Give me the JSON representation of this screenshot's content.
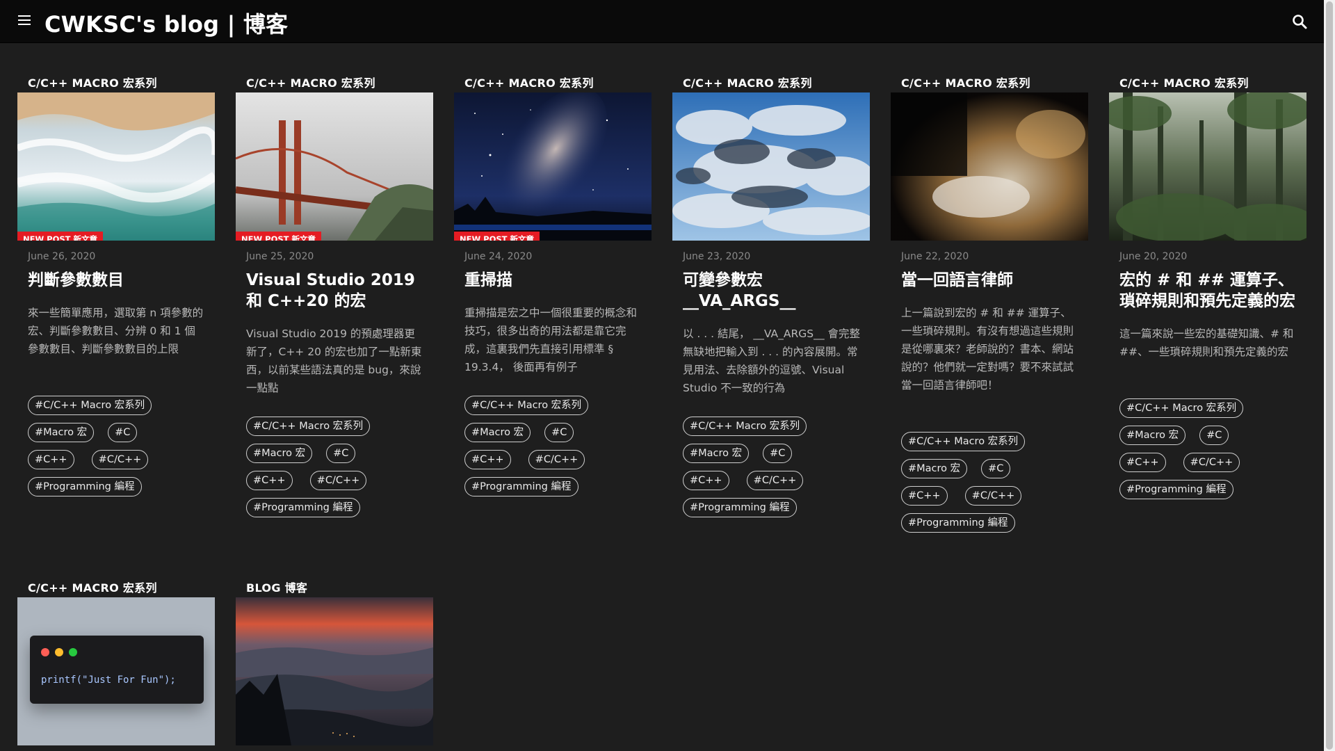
{
  "site": {
    "title": "CWKSC's blog | 博客"
  },
  "posts": [
    {
      "category": "C/C++ Macro 宏系列",
      "badge": "New Post 新文章",
      "date": "June 26, 2020",
      "title": "判斷參數數目",
      "excerpt": "來一些簡單應用，選取第 n 項參數的宏、判斷參數數目、分辨 0 和 1 個參數數目、判斷參數數目的上限",
      "tags": [
        "#C/C++ Macro 宏系列",
        "#Macro 宏",
        "#C",
        "#C++",
        "#C/C++",
        "#Programming 編程"
      ]
    },
    {
      "category": "C/C++ Macro 宏系列",
      "badge": "New Post 新文章",
      "date": "June 25, 2020",
      "title": "Visual Studio 2019 和 C++20 的宏",
      "excerpt": "Visual Studio 2019 的預處理器更新了，C++ 20 的宏也加了一點新東西，以前某些語法真的是 bug，來說一點點",
      "tags": [
        "#C/C++ Macro 宏系列",
        "#Macro 宏",
        "#C",
        "#C++",
        "#C/C++",
        "#Programming 編程"
      ]
    },
    {
      "category": "C/C++ Macro 宏系列",
      "badge": "New Post 新文章",
      "date": "June 24, 2020",
      "title": "重掃描",
      "excerpt": "重掃描是宏之中一個很重要的概念和技巧，很多出奇的用法都是靠它完成，這裏我們先直接引用標準 § 19.3.4， 後面再有例子",
      "tags": [
        "#C/C++ Macro 宏系列",
        "#Macro 宏",
        "#C",
        "#C++",
        "#C/C++",
        "#Programming 編程"
      ]
    },
    {
      "category": "C/C++ Macro 宏系列",
      "badge": "",
      "date": "June 23, 2020",
      "title": "可變參數宏 __VA_ARGS__",
      "excerpt": "以 . . . 結尾， __VA_ARGS__ 會完整無缺地把輸入到 . . . 的內容展開。常見用法、去除額外的逗號、Visual Studio 不一致的行為",
      "tags": [
        "#C/C++ Macro 宏系列",
        "#Macro 宏",
        "#C",
        "#C++",
        "#C/C++",
        "#Programming 編程"
      ]
    },
    {
      "category": "C/C++ Macro 宏系列",
      "badge": "",
      "date": "June 22, 2020",
      "title": "當一回語言律師",
      "excerpt": "上一篇說到宏的 # 和 ## 運算子、一些瑣碎規則。有沒有想過這些規則是從哪裏來？老師說的？書本、網站說的？他們就一定對嗎？要不來試試當一回語言律師吧！",
      "tags": [
        "#C/C++ Macro 宏系列",
        "#Macro 宏",
        "#C",
        "#C++",
        "#C/C++",
        "#Programming 編程"
      ]
    },
    {
      "category": "C/C++ Macro 宏系列",
      "badge": "",
      "date": "June 20, 2020",
      "title": "宏的 # 和 ## 運算子、瑣碎規則和預先定義的宏",
      "excerpt": "這一篇來說一些宏的基礎知識、# 和 ##、一些瑣碎規則和預先定義的宏",
      "tags": [
        "#C/C++ Macro 宏系列",
        "#Macro 宏",
        "#C",
        "#C++",
        "#C/C++",
        "#Programming 編程"
      ]
    },
    {
      "category": "C/C++ Macro 宏系列",
      "code": "printf(\"Just For Fun\");"
    },
    {
      "category": "Blog 博客"
    }
  ]
}
